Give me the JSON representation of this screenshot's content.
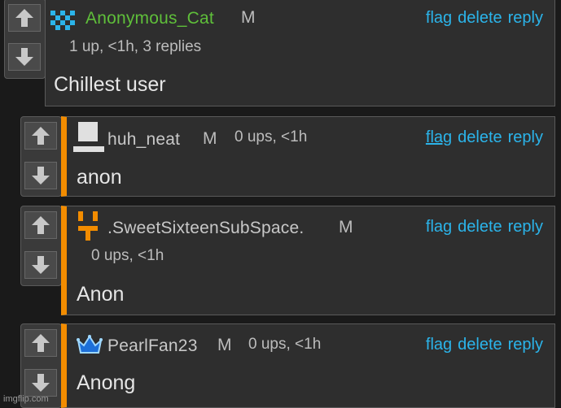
{
  "comments": [
    {
      "username": "Anonymous_Cat",
      "mod_badge": "M",
      "meta": "1 up, <1h, 3 replies",
      "body": "Chillest user",
      "avatar_icon": "cat-pixel-avatar-icon",
      "username_color": "#5fbf3a"
    },
    {
      "username": "huh_neat",
      "mod_badge": "M",
      "meta": "0 ups, <1h",
      "body": "anon",
      "avatar_icon": "computer-pixel-avatar-icon"
    },
    {
      "username": ".SweetSixteenSubSpace.",
      "mod_badge": "M",
      "meta": "0 ups, <1h",
      "body": "Anon",
      "avatar_icon": "orange-face-pixel-avatar-icon"
    },
    {
      "username": "PearlFan23",
      "mod_badge": "M",
      "meta": "0 ups, <1h",
      "body": "Anong",
      "avatar_icon": "crown-pixel-avatar-icon"
    }
  ],
  "actions": {
    "flag": "flag",
    "delete": "delete",
    "reply": "reply"
  },
  "watermark": "imgflip.com",
  "colors": {
    "accent_link": "#2bb4ea",
    "reply_bar": "#f28c00"
  }
}
